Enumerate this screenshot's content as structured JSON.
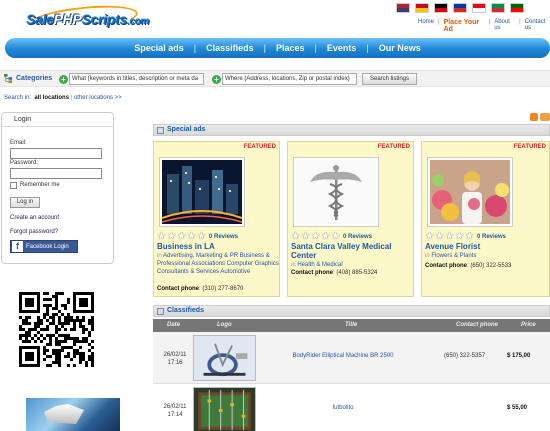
{
  "header": {
    "logo": {
      "part1": "Sale",
      "part2": "PHP",
      "part3": "Scripts",
      "part4": ".com"
    },
    "flags": [
      {
        "name": "us-flag-icon",
        "c1": "#b22234",
        "c2": "#3c3b6e"
      },
      {
        "name": "spain-flag-icon",
        "c1": "#c60b1e",
        "c2": "#ffc400"
      },
      {
        "name": "germany-flag-icon",
        "c1": "#000000",
        "c2": "#dd0000"
      },
      {
        "name": "russia-flag-icon",
        "c1": "#0039a6",
        "c2": "#d52b1e"
      },
      {
        "name": "turkey-flag-icon",
        "c1": "#e30a17",
        "c2": "#ffffff"
      },
      {
        "name": "italy-flag-icon",
        "c1": "#009246",
        "c2": "#ce2b37"
      },
      {
        "name": "portugal-flag-icon",
        "c1": "#006600",
        "c2": "#ff0000"
      }
    ],
    "links": {
      "home": "Home",
      "place_ad": "Place Your Ad",
      "about": "About us",
      "contact": "Contact us"
    }
  },
  "nav": [
    "Special ads",
    "Classifieds",
    "Places",
    "Events",
    "Our News"
  ],
  "search": {
    "categories_label": "Categories",
    "keywords_value": "What (keywords in titles, description or meta da",
    "where_value": "Where (Address, locations, Zip or postal index)",
    "button_label": "Search listings",
    "search_in_label": "Search in:",
    "all_locations": "all locations",
    "other_locations": "other locations >>"
  },
  "login": {
    "title": "Login",
    "email_label": "Email:",
    "password_label": "Password:",
    "remember_label": "Remember me",
    "login_button": "Log in",
    "create_account": "Create an account",
    "forgot_password": "Forgot password?",
    "facebook_login": "Facebook Login"
  },
  "special_ads": {
    "title": "Special ads",
    "featured_label": "FEATURED",
    "reviews_label": "0 Reviews",
    "phone_label": "Contact phone",
    "cards": [
      {
        "title": "Business in LA",
        "categories": "Advertising, Marketing & PR   Business & Professional Associations   Computer Graphics   Consultants & Services   Automotive",
        "phone": "(310) 277-8670"
      },
      {
        "title": "Santa Clara Valley Medical Center",
        "categories": "Health & Medical",
        "phone": "(408) 885-5324"
      },
      {
        "title": "Avenue Florist",
        "categories": "Flowers & Plants",
        "phone": "(650) 322-5533"
      }
    ]
  },
  "classifieds": {
    "title": "Classifieds",
    "columns": {
      "date": "Date",
      "logo": "Logo",
      "title": "Title",
      "phone": "Contact phone",
      "price": "Price"
    },
    "rows": [
      {
        "date": "26/02/11",
        "time": "17:16",
        "title": "BodyRider Elliptical Machine BR 2500",
        "phone": "(650) 322-5357",
        "price": "$ 175,00"
      },
      {
        "date": "26/02/11",
        "time": "17:14",
        "title": "futbolito",
        "phone": "",
        "price": "$ 55,00"
      }
    ]
  },
  "colors": {
    "nav_blue": "#1e87d6",
    "link_blue": "#1a5aa5",
    "featured_red": "#d02020",
    "card_bg": "#fdf8c8",
    "place_ad_orange": "#e05a00"
  }
}
